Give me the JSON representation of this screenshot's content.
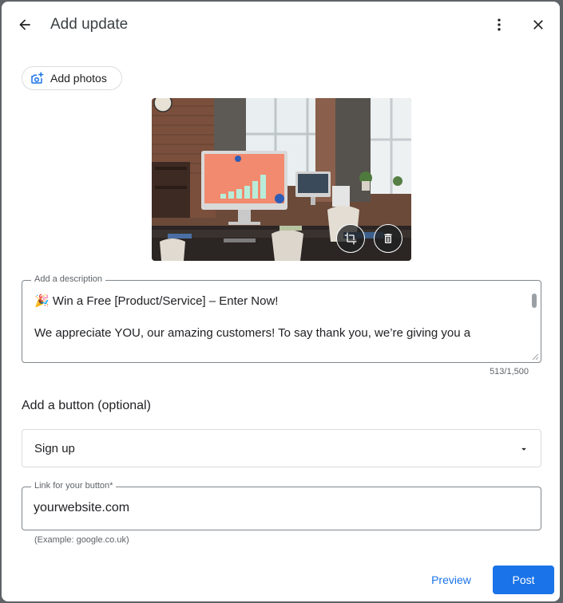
{
  "header": {
    "title": "Add update",
    "back_icon": "arrow-back-icon",
    "more_icon": "more-vert-icon",
    "close_icon": "close-icon"
  },
  "add_photos": {
    "label": "Add photos",
    "icon": "add-photo-icon"
  },
  "photo": {
    "crop_icon": "crop-icon",
    "delete_icon": "trash-icon"
  },
  "description": {
    "label": "Add a description",
    "value": "🎉 Win a Free [Product/Service] – Enter Now!\n\nWe appreciate YOU, our amazing customers! To say thank you, we’re giving you a",
    "counter": "513/1,500"
  },
  "button_section": {
    "title": "Add a button (optional)",
    "selected_option": "Sign up",
    "dropdown_icon": "arrow-drop-down-icon"
  },
  "link": {
    "label": "Link for your button*",
    "value": "yourwebsite.com",
    "helper": "(Example: google.co.uk)"
  },
  "actions": {
    "preview_label": "Preview",
    "post_label": "Post"
  },
  "colors": {
    "accent": "#1a73e8",
    "text": "#202124",
    "muted": "#5f6368",
    "border": "#dadce0"
  }
}
